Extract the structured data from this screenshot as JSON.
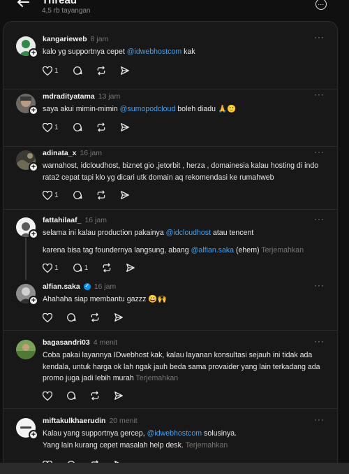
{
  "header": {
    "title": "Thread",
    "subtitle": "4,5 rb tayangan"
  },
  "translate_label": "Terjemahkan",
  "posts": [
    {
      "username": "kangarieweb",
      "time": "8 jam",
      "text_before": "kalo yg supportnya cepet ",
      "mention": "@idwebhostcom",
      "text_after": " kak",
      "likes": "1",
      "replies": ""
    },
    {
      "username": "mdradityatama",
      "time": "13 jam",
      "text_before": "saya akui mimin-mimin ",
      "mention": "@sumopodcloud",
      "text_after": " boleh diadu 🙏🙂",
      "likes": "1",
      "replies": ""
    },
    {
      "username": "adinata_x",
      "time": "16 jam",
      "text": "warnahost, idcloudhost, biznet gio ,jetorbit , herza , domainesia kalau hosting di indo rata2 cepat tapi klo yg dicari utk domain aq rekomendasi ke rumahweb",
      "likes": "1",
      "replies": ""
    },
    {
      "username": "fattahilaaf_",
      "time": "16 jam",
      "text_before": "selama ini kalau production pakainya ",
      "mention": "@idcloudhost",
      "text_after": " atau tencent",
      "text2_before": "karena bisa tag foundernya langsung, abang ",
      "mention2": "@alfian.saka",
      "text2_after": " (ehem)",
      "likes": "1",
      "replies": "1"
    },
    {
      "username": "alfian.saka",
      "time": "16 jam",
      "text": "Ahahaha siap membantu gazzz 😀🙌",
      "likes": "",
      "replies": ""
    },
    {
      "username": "bagasandri03",
      "time": "4 menit",
      "text": "Coba pakai layannya IDwebhost kak, kalau layanan konsultasi sejauh ini tidak ada kendala, untuk harga ok lah ngak jauh beda sama provaider yang lain terkadang ada promo juga jadi lebih murah",
      "likes": "",
      "replies": ""
    },
    {
      "username": "miftakulkhaerudin",
      "time": "20 menit",
      "text_before": "Kalau yang supportnya gercep, ",
      "mention": "@idwebhostcom",
      "text_after": " solusinya.",
      "text_line2": "Yang lain kurang cepet masalah help desk.",
      "likes": "",
      "replies": ""
    }
  ],
  "icons": {
    "back": "arrow-left-icon",
    "more": "more-circle-icon",
    "like": "heart-icon",
    "reply": "comment-icon",
    "repost": "repost-icon",
    "share": "send-icon"
  }
}
